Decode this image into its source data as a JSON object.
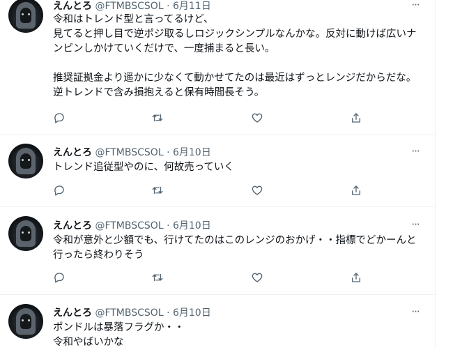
{
  "tweets": [
    {
      "name": "えんとろ",
      "handle": "@FTMBSCSOL",
      "separator": "·",
      "date": "6月11日",
      "more": "···",
      "text": "令和はトレンド型と言ってるけど、\n見てると押し目で逆ポジ取るしロジックシンプルなんかな。反対に動けば広いナンピンしかけていくだけで、一度捕まると長い。\n\n推奨証拠金より遥かに少なくて動かせてたのは最近はずっとレンジだからだな。\n逆トレンドで含み損抱えると保有時間長そう。"
    },
    {
      "name": "えんとろ",
      "handle": "@FTMBSCSOL",
      "separator": "·",
      "date": "6月10日",
      "more": "···",
      "text": "トレンド追従型やのに、何故売っていく"
    },
    {
      "name": "えんとろ",
      "handle": "@FTMBSCSOL",
      "separator": "·",
      "date": "6月10日",
      "more": "···",
      "text": "令和が意外と少額でも、行けてたのはこのレンジのおかげ・・指標でどかーんと行ったら終わりそう"
    },
    {
      "name": "えんとろ",
      "handle": "@FTMBSCSOL",
      "separator": "·",
      "date": "6月10日",
      "more": "···",
      "text": "ポンドルは暴落フラグか・・\n令和やばいかな"
    }
  ],
  "icons": {
    "reply": "reply-icon",
    "retweet": "retweet-icon",
    "like": "like-icon",
    "share": "share-icon"
  },
  "colors": {
    "text": "#0f1419",
    "secondary": "#536471",
    "divider": "#eff3f4"
  }
}
